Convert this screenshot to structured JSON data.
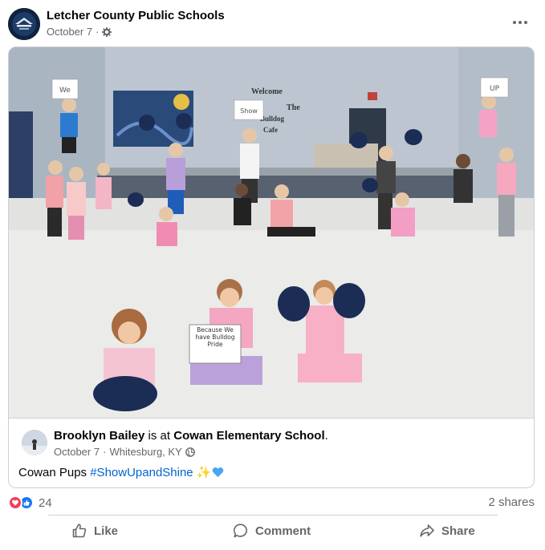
{
  "post": {
    "page_name": "Letcher County Public Schools",
    "date": "October 7",
    "separator": "·",
    "audience_icon": "gear-icon",
    "more_icon": "more-options-icon"
  },
  "shared": {
    "photo": {
      "signs": [
        "We",
        "Show",
        "UP",
        "Because We have Bulldog Pride"
      ],
      "wall_text": [
        "Welcome",
        "The",
        "Bulldog",
        "Cafe"
      ]
    },
    "author": "Brooklyn Bailey",
    "is_at": "is at",
    "place": "Cowan Elementary School",
    "period": ".",
    "date": "October 7",
    "separator": "·",
    "location": "Whitesburg, KY",
    "audience_icon": "globe-icon",
    "text_plain": "Cowan Pups ",
    "hashtag": "#ShowUpandShine",
    "emoji_sparkles": "✨",
    "emoji_heart": "blue-heart-icon"
  },
  "engagement": {
    "reaction_icons": [
      "love-icon",
      "like-icon"
    ],
    "reaction_count": "24",
    "shares": "2 shares"
  },
  "actions": {
    "like": "Like",
    "comment": "Comment",
    "share": "Share"
  },
  "colors": {
    "link": "#0064d1",
    "secondary_text": "#65676b",
    "like_blue": "#1877f2",
    "love_red": "#f33e58"
  }
}
